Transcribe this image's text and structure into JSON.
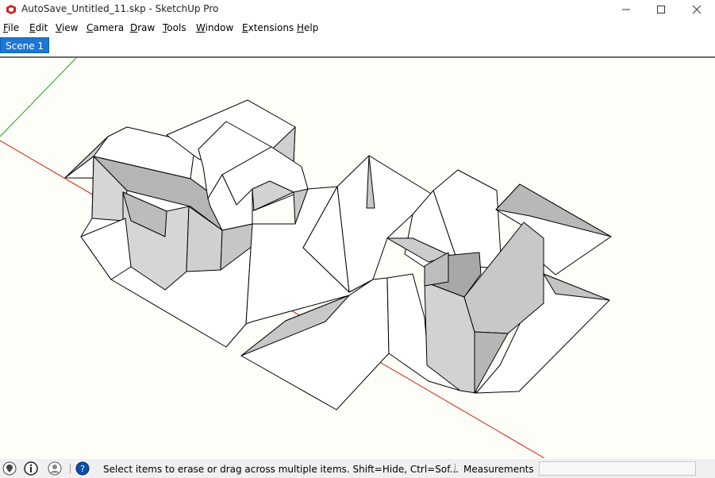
{
  "window": {
    "title": "AutoSave_Untitled_11.skp - SketchUp Pro",
    "controls": [
      "minimize-icon",
      "maximize-icon",
      "close-icon"
    ]
  },
  "menu": [
    {
      "label": "File",
      "accel": "F",
      "rest": "ile"
    },
    {
      "label": "Edit",
      "accel": "E",
      "rest": "dit"
    },
    {
      "label": "View",
      "accel": "V",
      "rest": "iew"
    },
    {
      "label": "Camera",
      "accel": "C",
      "rest": "amera"
    },
    {
      "label": "Draw",
      "accel": "D",
      "rest": "raw"
    },
    {
      "label": "Tools",
      "accel": "T",
      "rest": "ools"
    },
    {
      "label": "Window",
      "accel": "W",
      "rest": "indow"
    },
    {
      "label": "Extensions",
      "accel": "E",
      "rest": "xtensions"
    },
    {
      "label": "Help",
      "accel": "H",
      "rest": "elp"
    }
  ],
  "scenes": {
    "active": "Scene 1"
  },
  "status": {
    "icons": [
      "geolocation-icon",
      "credits-icon",
      "user-icon",
      "help-icon"
    ],
    "hint": "Select items to erase or drag across multiple items. Shift=Hide, Ctrl=Sof...",
    "measurements_label": "Measurements",
    "measurements_value": ""
  },
  "colors": {
    "scene_tab": "#1b78d6",
    "viewport_bg": "#fefef8",
    "red_axis": "#d02010",
    "green_axis": "#20a020",
    "face_light": "#ffffff",
    "face_shade": "#d4d4d4",
    "face_dark": "#b8b8b8"
  }
}
